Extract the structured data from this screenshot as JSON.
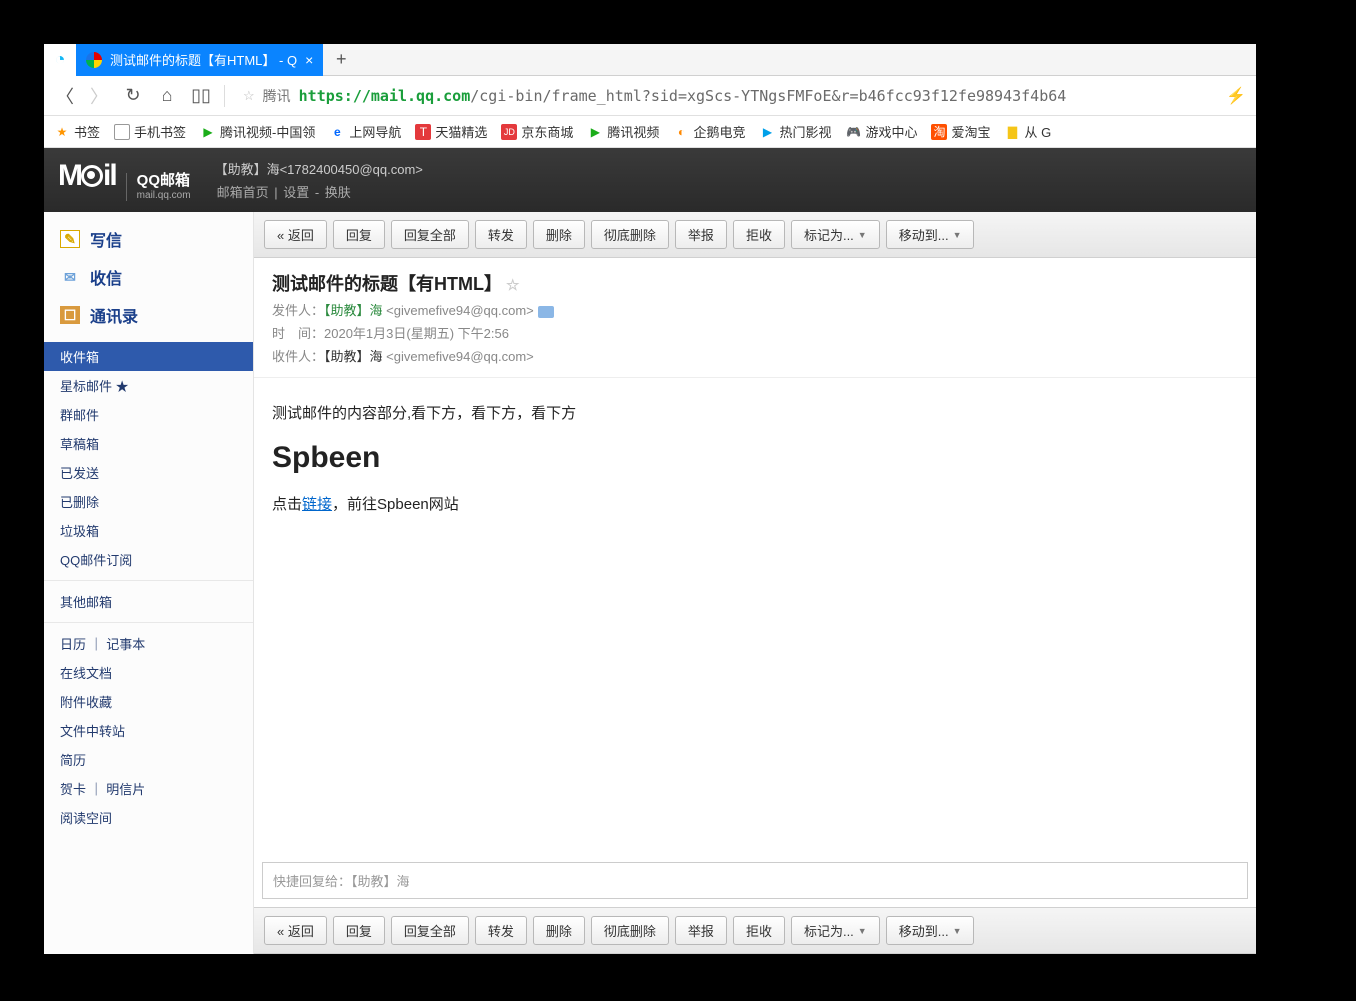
{
  "browser": {
    "tab_title": "测试邮件的标题【有HTML】 - Q",
    "brand": "腾讯",
    "url_green": "https://mail.qq.com",
    "url_rest": "/cgi-bin/frame_html?sid=xgScs-YTNgsFMFoE&r=b46fcc93f12fe98943f4b64"
  },
  "bookmarks": {
    "root": "书签",
    "items": [
      "手机书签",
      "腾讯视频-中国领",
      "上网导航",
      "天猫精选",
      "京东商城",
      "腾讯视频",
      "企鹅电竞",
      "热门影视",
      "游戏中心",
      "爱淘宝",
      "从 G"
    ]
  },
  "header": {
    "logo_main": "M⦿il",
    "logo_top": "QQ邮箱",
    "logo_sub": "mail.qq.com",
    "acct": "【助教】海<1782400450@qq.com>",
    "nav": [
      "邮箱首页",
      "设置",
      "换肤"
    ]
  },
  "sidebar": {
    "primary": [
      {
        "icon": "✎",
        "label": "写信"
      },
      {
        "icon": "✉",
        "label": "收信"
      },
      {
        "icon": "☐",
        "label": "通讯录"
      }
    ],
    "folders": [
      "收件箱",
      "星标邮件 ★",
      "群邮件",
      "草稿箱",
      "已发送",
      "已删除",
      "垃圾箱",
      "QQ邮件订阅"
    ],
    "other_label": "其他邮箱",
    "tools": [
      "日历 ｜ 记事本",
      "在线文档",
      "附件收藏",
      "文件中转站",
      "简历",
      "贺卡 ｜ 明信片",
      "阅读空间"
    ]
  },
  "toolbar": [
    "« 返回",
    "回复",
    "回复全部",
    "转发",
    "删除",
    "彻底删除",
    "举报",
    "拒收",
    "标记为...",
    "移动到..."
  ],
  "mail": {
    "subject": "测试邮件的标题【有HTML】",
    "from_lbl": "发件人：",
    "from_name": "【助教】海",
    "from_addr": "<givemefive94@qq.com>",
    "time_lbl": "时　间：",
    "time_val": "2020年1月3日(星期五) 下午2:56",
    "to_lbl": "收件人：",
    "to_name": "【助教】海",
    "to_addr": "<givemefive94@qq.com>",
    "body_p1": "测试邮件的内容部分,看下方，看下方，看下方",
    "body_h1": "Spbeen",
    "body_p2a": "点击",
    "body_link": "链接",
    "body_p2b": "，前往Spbeen网站"
  },
  "reply": {
    "prefix": "快捷回复给：",
    "to": "【助教】海"
  }
}
